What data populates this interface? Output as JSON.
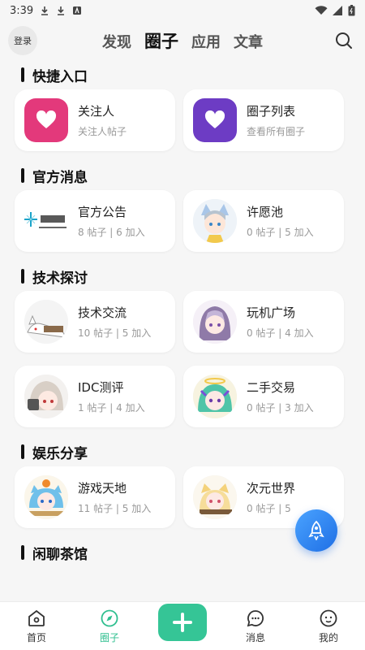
{
  "status_bar": {
    "time": "3:39"
  },
  "top_bar": {
    "login_label": "登录",
    "tabs": [
      {
        "label": "发现"
      },
      {
        "label": "圈子"
      },
      {
        "label": "应用"
      },
      {
        "label": "文章"
      }
    ],
    "active_tab": "圈子"
  },
  "sections": [
    {
      "title": "快捷入口",
      "cards": [
        {
          "title": "关注人",
          "subtitle": "关注人帖子",
          "icon": "heart-icon",
          "color": "#e3397b"
        },
        {
          "title": "圈子列表",
          "subtitle": "查看所有圈子",
          "icon": "heart-icon",
          "color": "#6d3cc4"
        }
      ]
    },
    {
      "title": "官方消息",
      "cards": [
        {
          "title": "官方公告",
          "subtitle": "8 帖子 | 6 加入",
          "icon": "official-logo"
        },
        {
          "title": "许愿池",
          "subtitle": "0 帖子 | 5 加入",
          "icon": "anime-avatar"
        }
      ]
    },
    {
      "title": "技术探讨",
      "cards": [
        {
          "title": "技术交流",
          "subtitle": "10 帖子 | 5 加入",
          "icon": "anime-avatar"
        },
        {
          "title": "玩机广场",
          "subtitle": "0 帖子 | 4 加入",
          "icon": "anime-avatar"
        },
        {
          "title": "IDC测评",
          "subtitle": "1 帖子 | 4 加入",
          "icon": "anime-avatar"
        },
        {
          "title": "二手交易",
          "subtitle": "0 帖子 | 3 加入",
          "icon": "anime-avatar"
        }
      ]
    },
    {
      "title": "娱乐分享",
      "cards": [
        {
          "title": "游戏天地",
          "subtitle": "11 帖子 | 5 加入",
          "icon": "anime-avatar"
        },
        {
          "title": "次元世界",
          "subtitle": "0 帖子 | 5",
          "icon": "anime-avatar"
        }
      ]
    },
    {
      "title": "闲聊茶馆",
      "cards": []
    }
  ],
  "tab_bar": {
    "items": [
      {
        "label": "首页",
        "icon": "home-icon"
      },
      {
        "label": "圈子",
        "icon": "compass-icon"
      },
      {
        "label": "",
        "icon": "plus-icon"
      },
      {
        "label": "消息",
        "icon": "chat-icon"
      },
      {
        "label": "我的",
        "icon": "profile-icon"
      }
    ],
    "active": "圈子"
  },
  "colors": {
    "accent": "#35c596",
    "active_tab": "#2fbf8f",
    "fab": "#1f6fe5"
  }
}
